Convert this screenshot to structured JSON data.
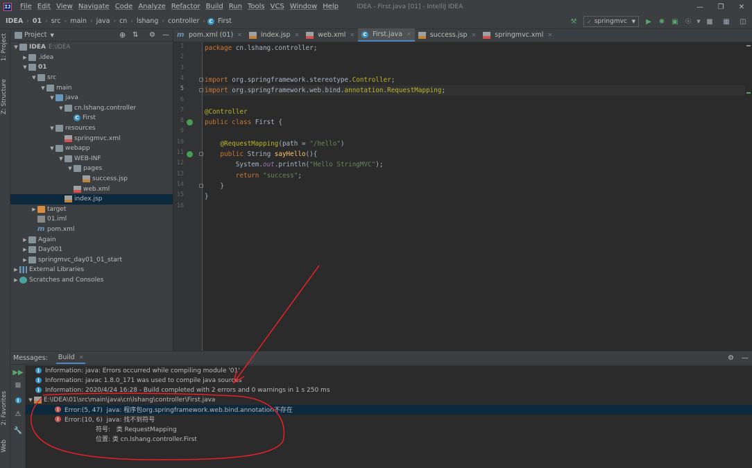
{
  "menubar": {
    "logo": "IJ",
    "items": [
      "File",
      "Edit",
      "View",
      "Navigate",
      "Code",
      "Analyze",
      "Refactor",
      "Build",
      "Run",
      "Tools",
      "VCS",
      "Window",
      "Help"
    ],
    "window_title": "IDEA - First.java [01] - IntelliJ IDEA"
  },
  "breadcrumbs": [
    "IDEA",
    "01",
    "src",
    "main",
    "java",
    "cn",
    "lshang",
    "controller",
    "First"
  ],
  "run_config": "springmvc",
  "left_strip": {
    "project": "1: Project",
    "structure": "Z: Structure",
    "favorites": "2: Favorites",
    "web": "Web"
  },
  "project_panel": {
    "title": "Project",
    "tree": [
      {
        "label": "IDEA",
        "extra": "E:\\IDEA",
        "depth": 0,
        "arrow": "down",
        "icon": "fold",
        "bold": true
      },
      {
        "label": ".idea",
        "depth": 1,
        "arrow": "right",
        "icon": "fold"
      },
      {
        "label": "01",
        "depth": 1,
        "arrow": "down",
        "icon": "fold",
        "bold": true
      },
      {
        "label": "src",
        "depth": 2,
        "arrow": "down",
        "icon": "fold"
      },
      {
        "label": "main",
        "depth": 3,
        "arrow": "down",
        "icon": "fold"
      },
      {
        "label": "java",
        "depth": 4,
        "arrow": "down",
        "icon": "fold-blue"
      },
      {
        "label": "cn.lshang.controller",
        "depth": 5,
        "arrow": "down",
        "icon": "fold"
      },
      {
        "label": "First",
        "depth": 6,
        "arrow": "",
        "icon": "cls"
      },
      {
        "label": "resources",
        "depth": 4,
        "arrow": "down",
        "icon": "fold"
      },
      {
        "label": "springmvc.xml",
        "depth": 5,
        "arrow": "",
        "icon": "fxml"
      },
      {
        "label": "webapp",
        "depth": 4,
        "arrow": "down",
        "icon": "fold"
      },
      {
        "label": "WEB-INF",
        "depth": 5,
        "arrow": "down",
        "icon": "fold"
      },
      {
        "label": "pages",
        "depth": 6,
        "arrow": "down",
        "icon": "fold"
      },
      {
        "label": "success.jsp",
        "depth": 7,
        "arrow": "",
        "icon": "fjsp"
      },
      {
        "label": "web.xml",
        "depth": 6,
        "arrow": "",
        "icon": "fxml"
      },
      {
        "label": "index.jsp",
        "depth": 5,
        "arrow": "",
        "icon": "fjsp",
        "selected": true
      },
      {
        "label": "target",
        "depth": 2,
        "arrow": "right",
        "icon": "fold-orange"
      },
      {
        "label": "01.iml",
        "depth": 2,
        "arrow": "",
        "icon": "fiml"
      },
      {
        "label": "pom.xml",
        "depth": 2,
        "arrow": "",
        "icon": "fm"
      },
      {
        "label": "Again",
        "depth": 1,
        "arrow": "right",
        "icon": "fold"
      },
      {
        "label": "Day001",
        "depth": 1,
        "arrow": "right",
        "icon": "fold"
      },
      {
        "label": "springmvc_day01_01_start",
        "depth": 1,
        "arrow": "right",
        "icon": "fold"
      },
      {
        "label": "External Libraries",
        "depth": 0,
        "arrow": "right",
        "icon": "lib"
      },
      {
        "label": "Scratches and Consoles",
        "depth": 0,
        "arrow": "right",
        "icon": "scr"
      }
    ]
  },
  "editor_tabs": [
    {
      "label": "pom.xml (01)",
      "icon": "fm"
    },
    {
      "label": "index.jsp",
      "icon": "fjsp"
    },
    {
      "label": "web.xml",
      "icon": "fxml"
    },
    {
      "label": "First.java",
      "icon": "cls",
      "active": true
    },
    {
      "label": "success.jsp",
      "icon": "fjsp"
    },
    {
      "label": "springmvc.xml",
      "icon": "fxml"
    }
  ],
  "code_lines": [
    [
      [
        "kw",
        "package "
      ],
      [
        "",
        "cn.lshang.controller;"
      ]
    ],
    [],
    [],
    [
      [
        "kw",
        "import "
      ],
      [
        "",
        "org.springframework.stereotype."
      ],
      [
        "an",
        "Controller"
      ],
      [
        "",
        ";"
      ]
    ],
    [
      [
        "kw",
        "import "
      ],
      [
        "",
        "org.springframework.web.bind."
      ],
      [
        "an",
        "annotation"
      ],
      [
        "",
        "."
      ],
      [
        "an",
        "RequestMapping"
      ],
      [
        "",
        ";"
      ]
    ],
    [],
    [
      [
        "an",
        "@Controller"
      ]
    ],
    [
      [
        "kw",
        "public class "
      ],
      [
        "",
        "First {"
      ]
    ],
    [],
    [
      [
        "",
        "    "
      ],
      [
        "an",
        "@RequestMapping"
      ],
      [
        "",
        "(path = "
      ],
      [
        "st",
        "\"/hello\""
      ],
      [
        "",
        ")"
      ]
    ],
    [
      [
        "",
        "    "
      ],
      [
        "kw",
        "public "
      ],
      [
        "",
        "String "
      ],
      [
        "fn",
        "sayHello"
      ],
      [
        "",
        "(){"
      ]
    ],
    [
      [
        "",
        "        System."
      ],
      [
        "pr",
        "out"
      ],
      [
        "",
        ".println("
      ],
      [
        "st",
        "\"Hello StringMVC\""
      ],
      [
        "",
        ");"
      ]
    ],
    [
      [
        "",
        "        "
      ],
      [
        "kw",
        "return "
      ],
      [
        "st",
        "\"success\""
      ],
      [
        "",
        ";"
      ]
    ],
    [
      [
        "",
        "    }"
      ]
    ],
    [
      [
        "",
        "}"
      ]
    ],
    []
  ],
  "current_line": 5,
  "bottom_panel": {
    "messages_label": "Messages:",
    "tab_label": "Build",
    "rows": [
      {
        "type": "info",
        "indent": 0,
        "text": "Information: java: Errors occurred while compiling module '01'"
      },
      {
        "type": "info",
        "indent": 0,
        "text": "Information: javac 1.8.0_171 was used to compile java sources"
      },
      {
        "type": "info",
        "indent": 0,
        "text": "Information: 2020/4/24 16:28 - Build completed with 2 errors and 0 warnings in 1 s 250 ms"
      },
      {
        "type": "file",
        "indent": 0,
        "text": "E:\\IDEA\\01\\src\\main\\java\\cn\\lshang\\controller\\First.java"
      },
      {
        "type": "error",
        "indent": 1,
        "text": "Error:(5, 47)  java: 程序包org.springframework.web.bind.annotation不存在",
        "selected": true
      },
      {
        "type": "error",
        "indent": 1,
        "text": "Error:(10, 6)  java: 找不到符号"
      },
      {
        "type": "plain",
        "indent": 2,
        "text": "符号:   类 RequestMapping"
      },
      {
        "type": "plain",
        "indent": 2,
        "text": "位置: 类 cn.lshang.controller.First"
      }
    ]
  },
  "colors": {
    "accent": "#4a88c7",
    "annotation_red": "#e8202a"
  }
}
